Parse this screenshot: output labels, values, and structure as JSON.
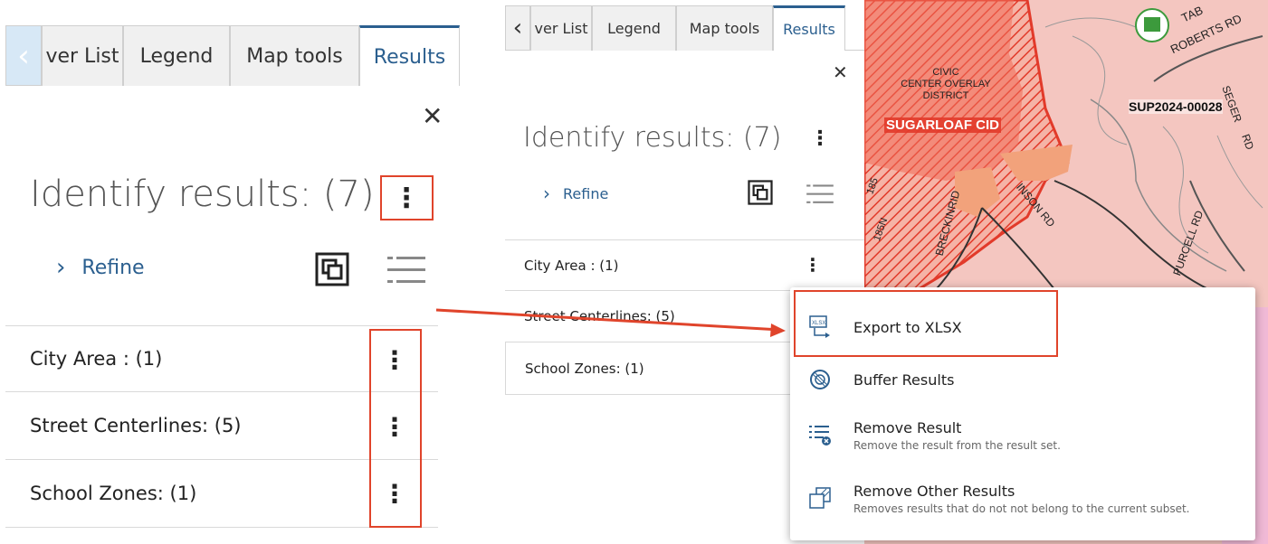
{
  "left_panel": {
    "tabs": [
      "ver List",
      "Legend",
      "Map tools",
      "Results"
    ],
    "title": "Identify results: (7)",
    "refine_label": "Refine",
    "rows": [
      "City Area : (1)",
      "Street Centerlines: (5)",
      "School Zones: (1)"
    ]
  },
  "right_panel": {
    "tabs": [
      "ver List",
      "Legend",
      "Map tools",
      "Results"
    ],
    "title": "Identify results: (7)",
    "refine_label": "Refine",
    "rows": [
      "City Area : (1)",
      "Street Centerlines: (5)",
      "School Zones: (1)"
    ]
  },
  "context_menu": {
    "items": [
      {
        "title": "Export to XLSX",
        "subtitle": "",
        "icon": "export-xlsx-icon"
      },
      {
        "title": "Buffer Results",
        "subtitle": "",
        "icon": "buffer-icon"
      },
      {
        "title": "Remove Result",
        "subtitle": "Remove the result from the result set.",
        "icon": "remove-result-icon"
      },
      {
        "title": "Remove Other Results",
        "subtitle": "Removes results that do not not belong to the current subset.",
        "icon": "remove-other-icon"
      }
    ]
  },
  "map": {
    "labels": {
      "civic": "CIVIC\nCENTER OVERLAY\nDISTRICT",
      "cid": "SUGARLOAF CID",
      "permit": "SUP2024-00028",
      "roberts": "ROBERTS RD",
      "tab": "TAB",
      "purcell": "PURCELL RD",
      "inson": "INSON RD",
      "breck": "BRECKINRID",
      "rd": "RD",
      "seger": "SEGER",
      "n85": "185",
      "n85n": "185N"
    }
  },
  "colors": {
    "accent": "#2b5f8f",
    "highlight_box": "#e0442b",
    "arrow": "#e0442b",
    "map_pink": "#f4c6c0",
    "map_red": "#f06a55",
    "map_orange": "#f2a27b"
  }
}
